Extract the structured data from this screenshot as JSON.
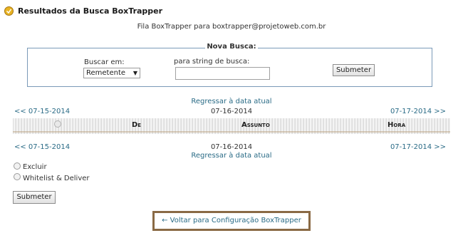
{
  "header": {
    "title": "Resultados da Busca BoxTrapper",
    "icon": "boxtrapper-icon"
  },
  "queue_text": "Fila BoxTrapper para boxtrapper@projetoweb.com.br",
  "search": {
    "legend": "Nova Busca:",
    "field_label": "Buscar em:",
    "field_selected": "Remetente",
    "string_label": "para string de busca:",
    "string_value": "",
    "submit_label": "Submeter"
  },
  "nav": {
    "return_label": "Regressar à data atual",
    "prev": "<< 07-15-2014",
    "current": "07-16-2014",
    "next": "07-17-2014 >>"
  },
  "table": {
    "columns": [
      "De",
      "Assunto",
      "Hora"
    ],
    "rows": []
  },
  "actions": {
    "options": [
      "Excluir",
      "Whitelist & Deliver"
    ],
    "submit_label": "Submeter"
  },
  "back_link": "← Voltar para Configuração BoxTrapper"
}
